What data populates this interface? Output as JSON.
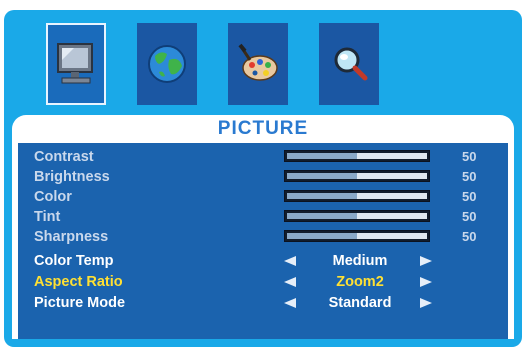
{
  "menu": {
    "tabs": [
      {
        "icon": "monitor-icon",
        "active": true
      },
      {
        "icon": "globe-icon",
        "active": false
      },
      {
        "icon": "palette-icon",
        "active": false
      },
      {
        "icon": "magnifier-icon",
        "active": false
      }
    ],
    "title": "PICTURE",
    "sliders": [
      {
        "label": "Contrast",
        "value": "50",
        "level": 0.5
      },
      {
        "label": "Brightness",
        "value": "50",
        "level": 0.5
      },
      {
        "label": "Color",
        "value": "50",
        "level": 0.5
      },
      {
        "label": "Tint",
        "value": "50",
        "level": 0.5
      },
      {
        "label": "Sharpness",
        "value": "50",
        "level": 0.5
      }
    ],
    "options": [
      {
        "label": "Color Temp",
        "value": "Medium",
        "highlighted": false
      },
      {
        "label": "Aspect Ratio",
        "value": "Zoom2",
        "highlighted": true
      },
      {
        "label": "Picture Mode",
        "value": "Standard",
        "highlighted": false
      }
    ]
  },
  "colors": {
    "frame": "#1aa9e8",
    "list_background": "#1b63ae",
    "title": "#2a7ad0",
    "highlight": "#ffe033"
  }
}
